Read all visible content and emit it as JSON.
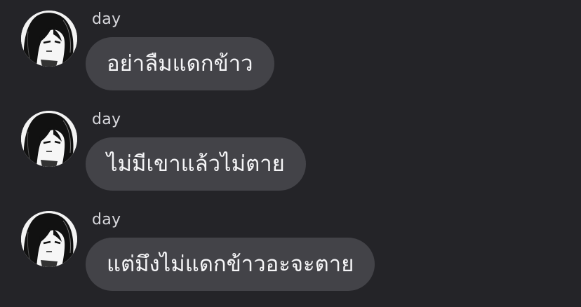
{
  "messages": [
    {
      "sender": "day",
      "text": "อย่าลืมแดกข้าว",
      "avatar_icon": "avatar-icon"
    },
    {
      "sender": "day",
      "text": "ไม่มีเขาแล้วไม่ตาย",
      "avatar_icon": "avatar-icon"
    },
    {
      "sender": "day",
      "text": "แต่มึงไม่แดกข้าวอะจะตาย",
      "avatar_icon": "avatar-icon"
    }
  ],
  "colors": {
    "background": "#242428",
    "bubble": "#434348",
    "bubble_text": "#f5f5f7",
    "sender_text": "#d7d7dc"
  }
}
